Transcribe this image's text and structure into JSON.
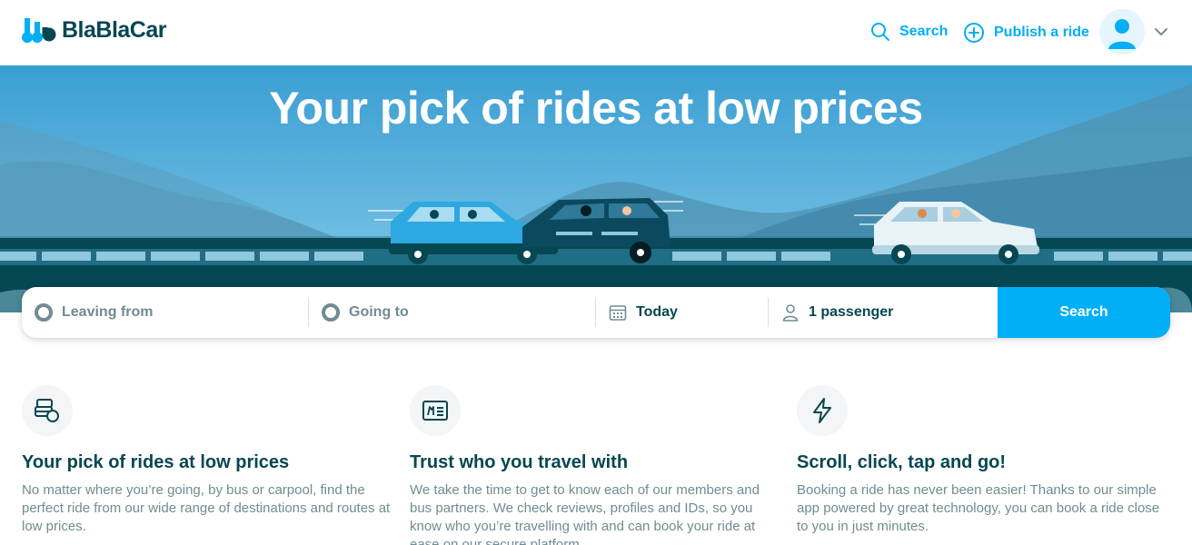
{
  "header": {
    "logo_text": "BlaBlaCar",
    "search_label": "Search",
    "publish_label": "Publish a ride"
  },
  "hero": {
    "title": "Your pick of rides at low prices"
  },
  "searchbar": {
    "from_placeholder": "Leaving from",
    "to_placeholder": "Going to",
    "date_value": "Today",
    "passengers_value": "1 passenger",
    "button_label": "Search"
  },
  "features": [
    {
      "icon": "bus-car-icon",
      "title": "Your pick of rides at low prices",
      "text": "No matter where you’re going, by bus or carpool, find the perfect ride from our wide range of destinations and routes at low prices."
    },
    {
      "icon": "id-card-icon",
      "title": "Trust who you travel with",
      "text": "We take the time to get to know each of our members and bus partners. We check reviews, profiles and IDs, so you know who you’re travelling with and can book your ride at ease on our secure platform."
    },
    {
      "icon": "lightning-icon",
      "title": "Scroll, click, tap and go!",
      "text": "Booking a ride has never been easier! Thanks to our simple app powered by great technology, you can book a ride close to you in just minutes."
    }
  ],
  "colors": {
    "brand_blue": "#00AFF5",
    "dark_teal": "#054752",
    "muted_text": "#708c91"
  }
}
